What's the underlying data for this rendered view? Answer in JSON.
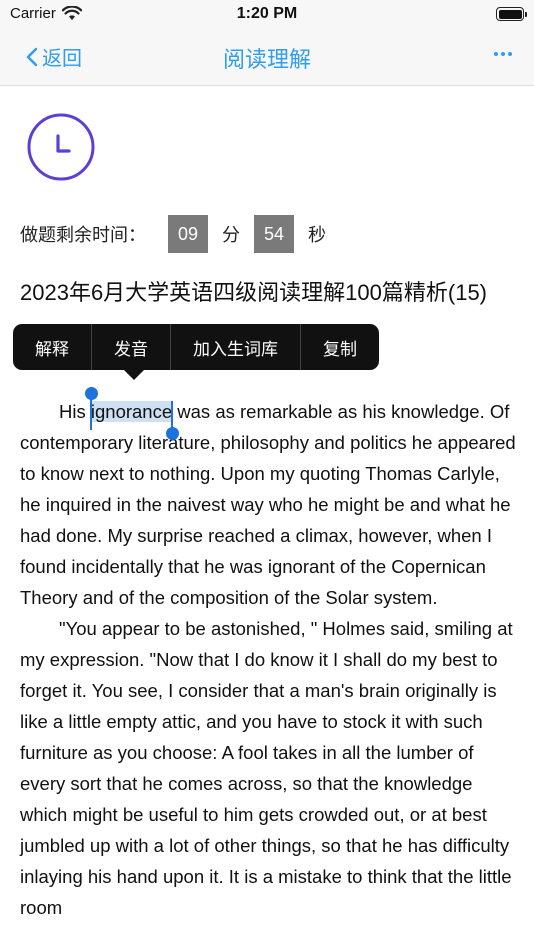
{
  "status_bar": {
    "carrier": "Carrier",
    "time": "1:20 PM"
  },
  "nav": {
    "back_label": "返回",
    "title": "阅读理解"
  },
  "timer": {
    "label": "做题剩余时间：",
    "minutes": "09",
    "minute_unit": "分",
    "seconds": "54",
    "second_unit": "秒"
  },
  "article": {
    "title": "2023年6月大学英语四级阅读理解100篇精析(15)",
    "p1_before": "His ",
    "p1_selected": "ignorance",
    "p1_after": " was as remarkable as his knowledge. Of contemporary literature, philosophy and politics he appeared to know next to nothing. Upon my quoting Thomas Carlyle, he inquired in the naivest way who he might be and what he had done. My surprise reached a climax, however, when I found incidentally that he was ignorant of the Copernican Theory and of the composition of the Solar system.",
    "p2": "\"You appear to be astonished, \" Holmes said, smiling at my expression. \"Now that I do know it I shall do my best to forget it. You see, I consider that a man's brain originally is like a little empty attic, and you have to stock it with such furniture as you choose: A fool takes in all the lumber of every sort that he comes across, so that the knowledge which might be useful to him gets crowded out, or at best jumbled up with a lot of other things, so that he has difficulty inlaying his hand upon it. It is a mistake to think that the little room"
  },
  "context_menu": {
    "items": [
      "解释",
      "发音",
      "加入生词库",
      "复制"
    ]
  },
  "colors": {
    "accent": "#2e9df2",
    "clock": "#5b3fd6",
    "selection": "#cfe0f3",
    "handle": "#1b73dd"
  }
}
